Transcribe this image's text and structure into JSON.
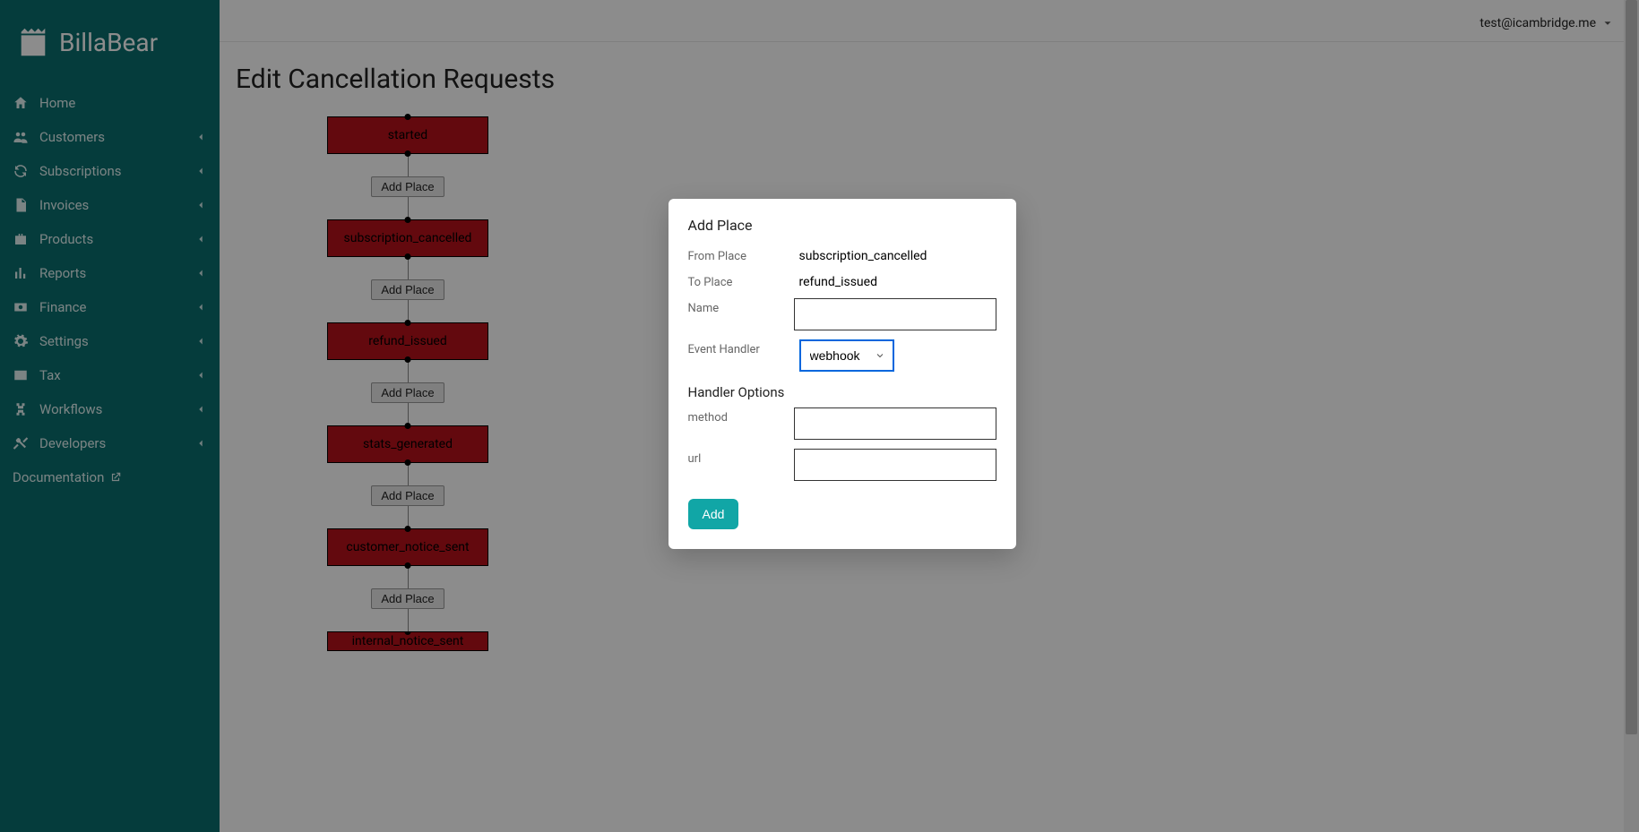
{
  "brand": {
    "name": "BillaBear"
  },
  "user": {
    "email": "test@icambridge.me"
  },
  "sidebar": {
    "items": [
      {
        "label": "Home",
        "icon": "home",
        "expandable": false
      },
      {
        "label": "Customers",
        "icon": "users",
        "expandable": true
      },
      {
        "label": "Subscriptions",
        "icon": "refresh",
        "expandable": true
      },
      {
        "label": "Invoices",
        "icon": "file",
        "expandable": true
      },
      {
        "label": "Products",
        "icon": "briefcase",
        "expandable": true
      },
      {
        "label": "Reports",
        "icon": "chart",
        "expandable": true
      },
      {
        "label": "Finance",
        "icon": "cash",
        "expandable": true
      },
      {
        "label": "Settings",
        "icon": "gear",
        "expandable": true
      },
      {
        "label": "Tax",
        "icon": "card",
        "expandable": true
      },
      {
        "label": "Workflows",
        "icon": "flow",
        "expandable": true
      },
      {
        "label": "Developers",
        "icon": "tools",
        "expandable": true
      }
    ],
    "doc_label": "Documentation"
  },
  "page": {
    "title": "Edit Cancellation Requests"
  },
  "workflow": {
    "nodes": [
      "started",
      "subscription_cancelled",
      "refund_issued",
      "stats_generated",
      "customer_notice_sent",
      "internal_notice_sent"
    ],
    "add_label": "Add Place"
  },
  "modal": {
    "title": "Add Place",
    "labels": {
      "from": "From Place",
      "to": "To Place",
      "name": "Name",
      "handler": "Event Handler",
      "options": "Handler Options",
      "method": "method",
      "url": "url"
    },
    "from_value": "subscription_cancelled",
    "to_value": "refund_issued",
    "name_value": "",
    "handler_value": "webhook",
    "method_value": "",
    "url_value": "",
    "submit": "Add"
  }
}
